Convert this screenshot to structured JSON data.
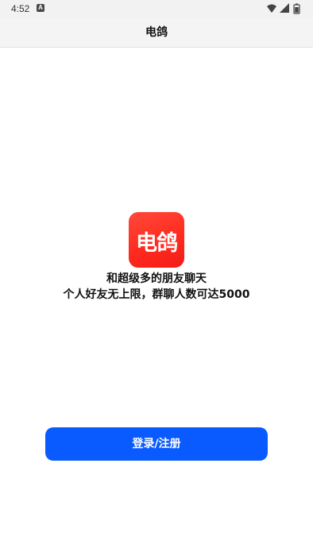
{
  "status_bar": {
    "time": "4:52",
    "notification_icon": "a-icon",
    "icons": [
      "wifi-icon",
      "signal-icon",
      "battery-icon"
    ]
  },
  "header": {
    "title": "电鸽"
  },
  "logo": {
    "text": "电鸽",
    "color": "#ff3323"
  },
  "slogan": {
    "line1": "和超级多的朋友聊天",
    "line2": "个人好友无上限，群聊人数可达5000"
  },
  "login": {
    "label": "登录/注册",
    "color": "#0a5bff"
  }
}
